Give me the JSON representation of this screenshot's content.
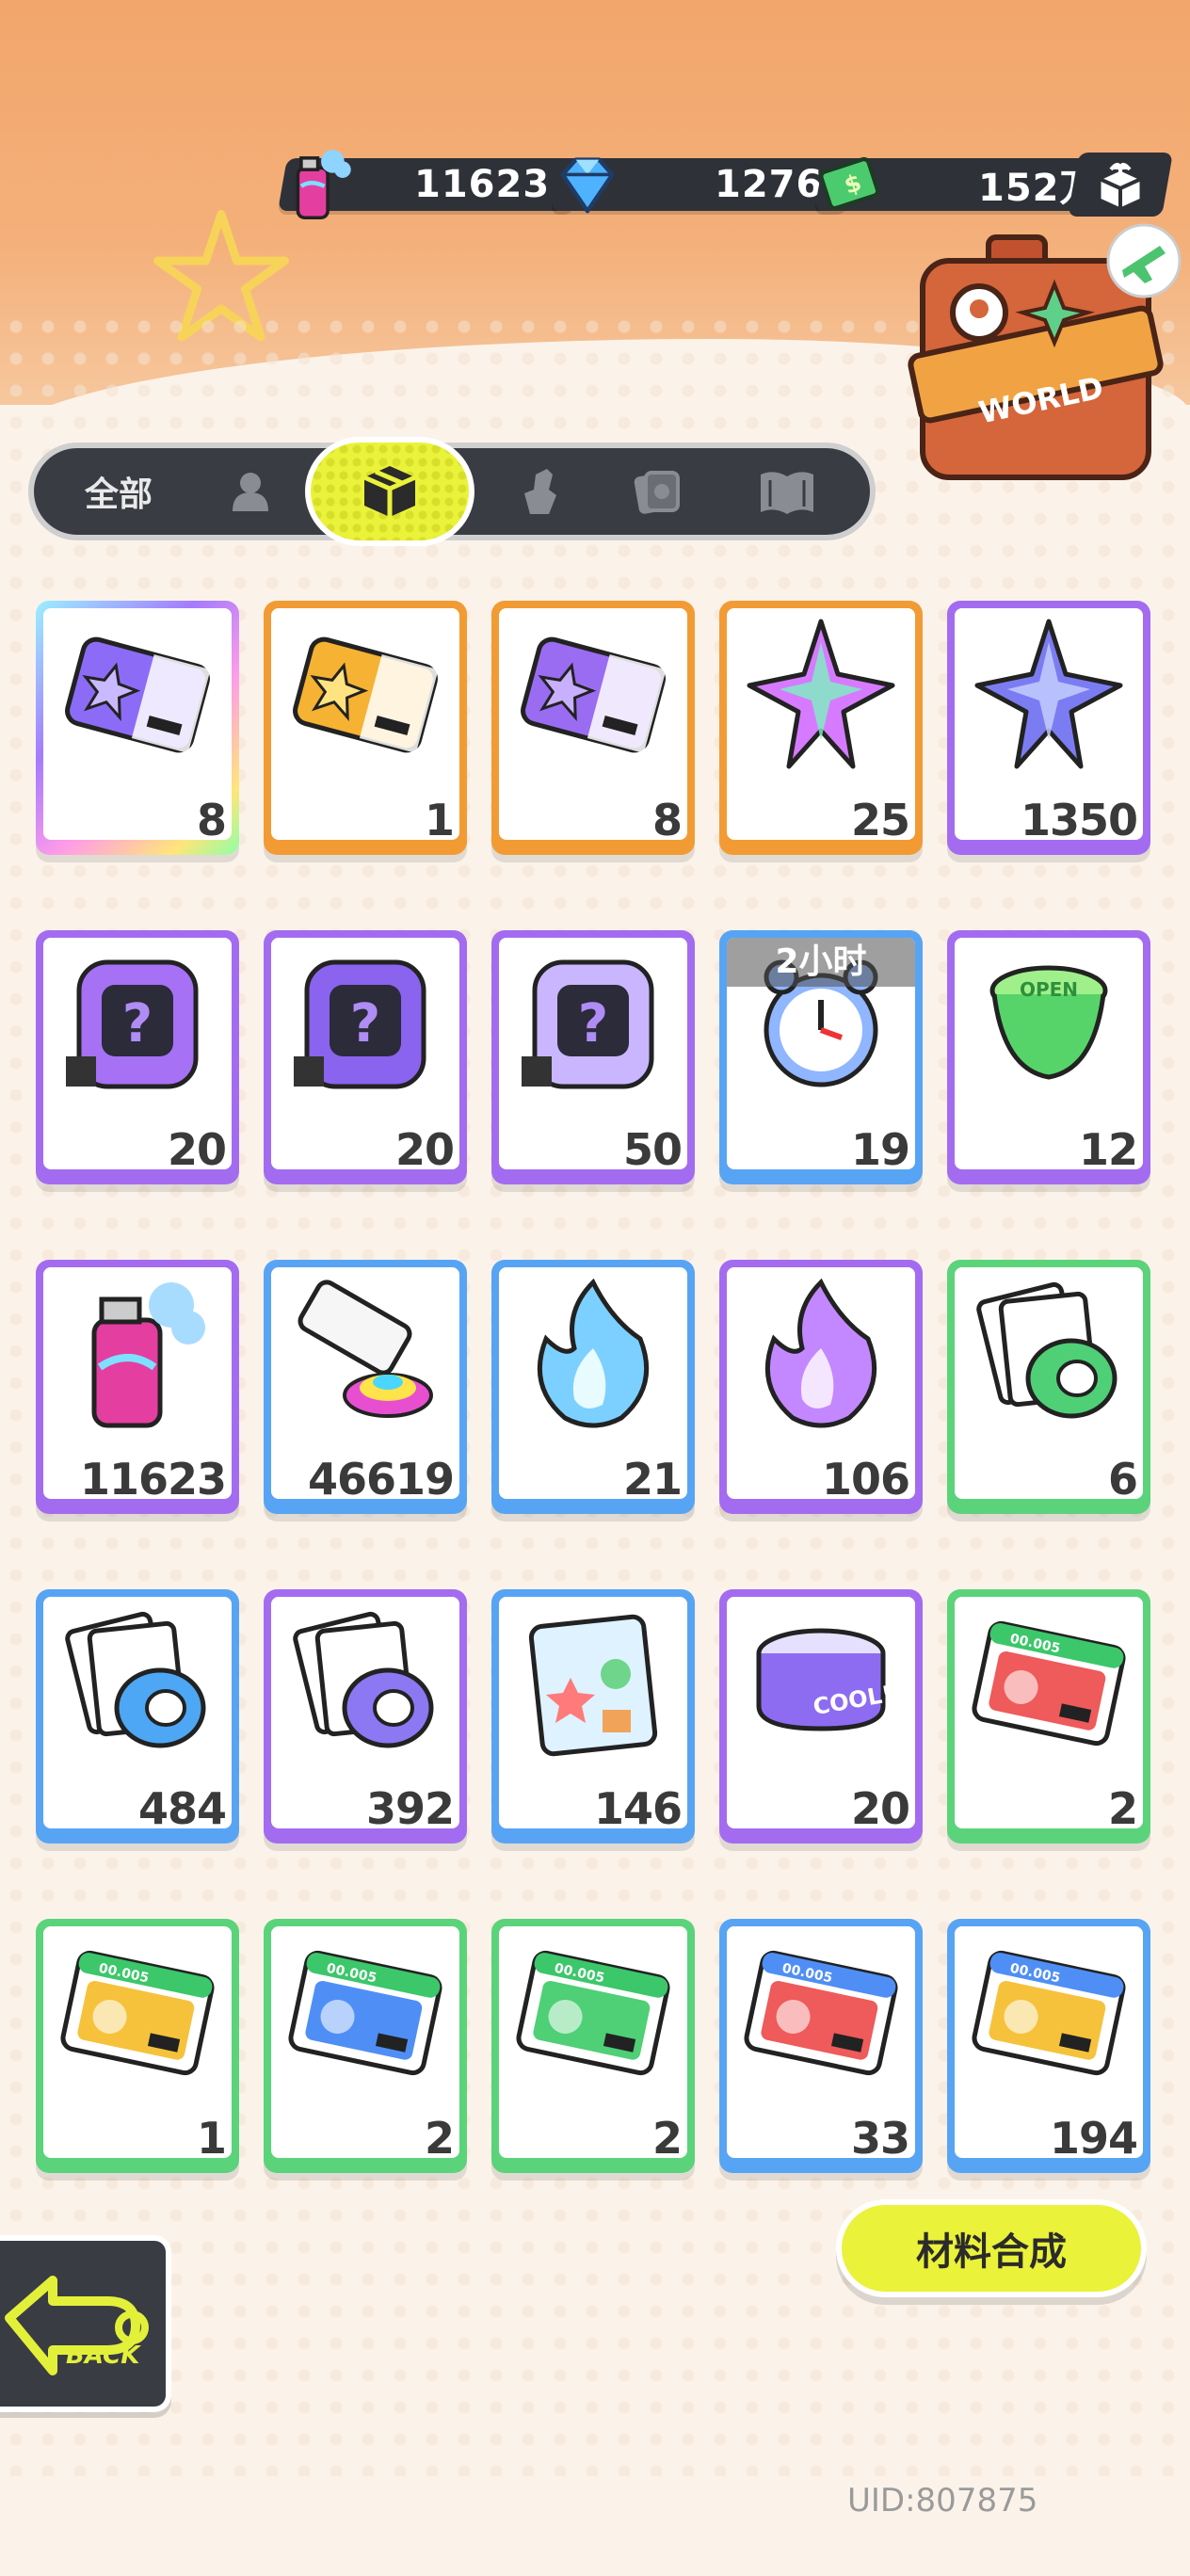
{
  "currencies": [
    {
      "name": "paint-spray",
      "value": "11623"
    },
    {
      "name": "diamond",
      "value": "1276"
    },
    {
      "name": "cash",
      "value": "152万"
    }
  ],
  "tabs": {
    "all_label": "全部",
    "items": [
      "person-icon",
      "box-icon",
      "hand-icon",
      "cards-icon",
      "book-icon"
    ],
    "active": "box-icon"
  },
  "world_bag_label": "WORLD",
  "items": [
    {
      "name": "deity-ticket-rainbow",
      "rarity": "rainbow",
      "count": "8"
    },
    {
      "name": "deity-ticket-gold",
      "rarity": "orange",
      "count": "1"
    },
    {
      "name": "deity-ticket-purple",
      "rarity": "orange",
      "count": "8"
    },
    {
      "name": "rainbow-star-shard",
      "rarity": "orange",
      "count": "25"
    },
    {
      "name": "blue-star-shard",
      "rarity": "purple",
      "count": "1350"
    },
    {
      "name": "mystery-egg",
      "rarity": "purple",
      "count": "20"
    },
    {
      "name": "mystery-deity-badge",
      "rarity": "purple",
      "count": "20"
    },
    {
      "name": "mystery-travel-card",
      "rarity": "purple",
      "count": "50"
    },
    {
      "name": "alarm-clock",
      "rarity": "blue",
      "count": "19",
      "timer": "2小时"
    },
    {
      "name": "green-cup",
      "rarity": "purple",
      "count": "12"
    },
    {
      "name": "spray-can",
      "rarity": "purple",
      "count": "11623"
    },
    {
      "name": "paint-tube",
      "rarity": "blue",
      "count": "46619"
    },
    {
      "name": "blue-flame",
      "rarity": "blue",
      "count": "21"
    },
    {
      "name": "purple-flame",
      "rarity": "purple",
      "count": "106"
    },
    {
      "name": "green-tape",
      "rarity": "green",
      "count": "6"
    },
    {
      "name": "blue-tape",
      "rarity": "blue",
      "count": "484"
    },
    {
      "name": "purple-tape",
      "rarity": "purple",
      "count": "392"
    },
    {
      "name": "sticker-pack",
      "rarity": "blue",
      "count": "146"
    },
    {
      "name": "cool-can",
      "rarity": "purple",
      "count": "20"
    },
    {
      "name": "red-coupon",
      "rarity": "green",
      "count": "2"
    },
    {
      "name": "yellow-coupon",
      "rarity": "green",
      "count": "1"
    },
    {
      "name": "blue-coupon",
      "rarity": "green",
      "count": "2"
    },
    {
      "name": "green-coupon",
      "rarity": "green",
      "count": "2"
    },
    {
      "name": "red-coupon-2",
      "rarity": "blue",
      "count": "33"
    },
    {
      "name": "yellow-coupon-2",
      "rarity": "blue",
      "count": "194"
    }
  ],
  "synth_button": "材料合成",
  "back_label": "BACK",
  "uid": "UID:807875"
}
